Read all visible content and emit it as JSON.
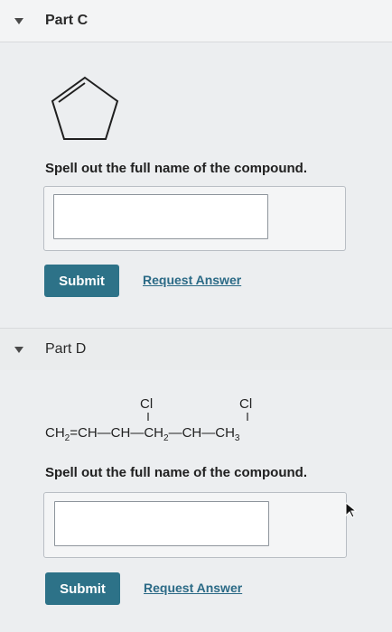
{
  "part_c": {
    "title": "Part C",
    "question": "Spell out the full name of the compound.",
    "answer_value": "",
    "submit_label": "Submit",
    "request_label": "Request Answer"
  },
  "part_d": {
    "title": "Part D",
    "question": "Spell out the full name of the compound.",
    "answer_value": "",
    "submit_label": "Submit",
    "request_label": "Request Answer",
    "substituent": "Cl",
    "chain": [
      "CH",
      "2",
      "=CH—",
      "CH",
      "—CH",
      "2",
      "—",
      "CH",
      "—CH",
      "3"
    ]
  },
  "icons": {
    "expand": "caret-down-icon"
  },
  "colors": {
    "submit_bg": "#2d7288",
    "link": "#2b6a86"
  }
}
